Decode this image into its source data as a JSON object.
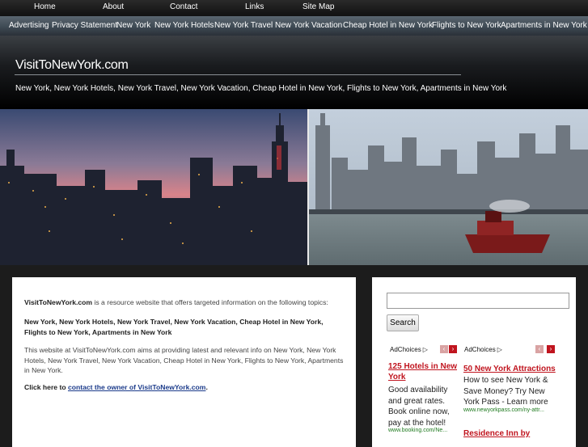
{
  "topnav": {
    "items": [
      "Home",
      "About",
      "Contact",
      "Links",
      "Site Map"
    ]
  },
  "subnav": {
    "items": [
      "Advertising",
      "Privacy Statement",
      "New York",
      "New York Hotels",
      "New York Travel",
      "New York Vacation",
      "Cheap Hotel in New York",
      "Flights to New York",
      "Apartments in New York"
    ]
  },
  "header": {
    "title": "VisitToNewYork.com",
    "tagline": "New York, New York Hotels, New York Travel, New York Vacation, Cheap Hotel in New York, Flights to New York, Apartments in New York"
  },
  "main": {
    "intro_site": "VisitToNewYork.com",
    "intro_rest": " is a resource website that offers targeted information on the following topics:",
    "topics": "New York, New York Hotels, New York Travel, New York Vacation, Cheap Hotel in New York, Flights to New York, Apartments in New York",
    "aim": "This website at VisitToNewYork.com aims at providing latest and relevant info on New York, New York Hotels, New York Travel, New York Vacation, Cheap Hotel in New York, Flights to New York, Apartments in New York.",
    "contact_prefix": "Click here to ",
    "contact_link": "contact the owner of VisitToNewYork.com",
    "contact_suffix": "."
  },
  "sidebar": {
    "search_placeholder": "",
    "search_button": "Search",
    "ads": [
      {
        "adchoices": "AdChoices",
        "title": "125 Hotels in New York",
        "body": "Good availability and great rates. Book online now, pay at the hotel!",
        "url": "www.booking.com/Ne..."
      },
      {
        "adchoices": "AdChoices",
        "title": "50 New York Attractions",
        "body": "How to see New York & Save Money? Try New York Pass - Learn more",
        "url": "www.newyorkpass.com/ny-attr...",
        "next_title": "Residence Inn by"
      }
    ]
  },
  "colors": {
    "ad_title": "#c0141e",
    "link": "#1a3a8a",
    "ad_url": "#1f7a1f",
    "arrow_inactive": "#d9a3a3",
    "arrow_active": "#c0141e"
  }
}
